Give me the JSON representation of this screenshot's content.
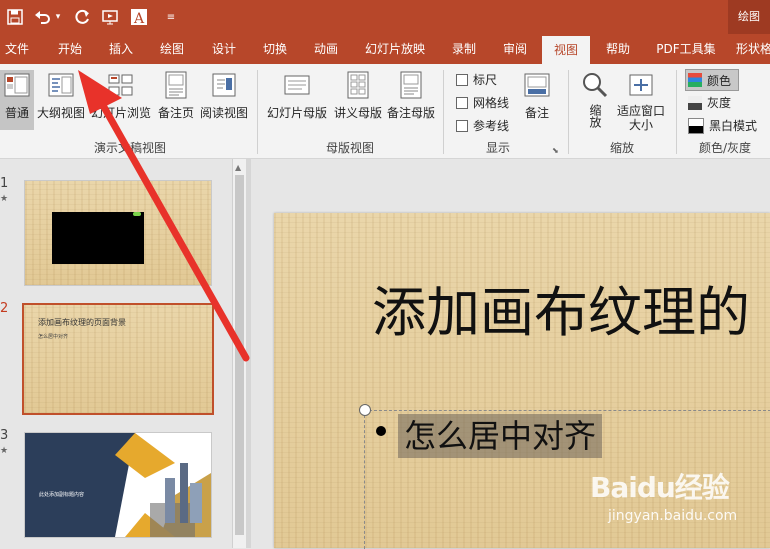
{
  "title_bar": {
    "context_title": "绘图",
    "qat_icons": [
      "save-icon",
      "undo-icon",
      "undo-dropdown-icon",
      "redo-icon",
      "present-from-start-icon",
      "text-style-icon",
      "customize-qat-icon"
    ]
  },
  "tabs": [
    "文件",
    "开始",
    "插入",
    "绘图",
    "设计",
    "切换",
    "动画",
    "幻灯片放映",
    "录制",
    "审阅",
    "视图",
    "帮助",
    "PDF工具集",
    "形状格"
  ],
  "active_tab": "视图",
  "ribbon": {
    "presentation_views": {
      "label": "演示文稿视图",
      "buttons": [
        "普通",
        "大纲视图",
        "幻灯片浏览",
        "备注页",
        "阅读视图"
      ],
      "selected": "普通"
    },
    "master_views": {
      "label": "母版视图",
      "buttons": [
        "幻灯片母版",
        "讲义母版",
        "备注母版"
      ]
    },
    "show": {
      "label": "显示",
      "checkboxes": [
        "标尺",
        "网格线",
        "参考线"
      ],
      "notes_button": "备注"
    },
    "zoom": {
      "label": "缩放",
      "buttons": [
        "缩放",
        "适应窗口大小"
      ]
    },
    "color_grayscale": {
      "label": "颜色/灰度",
      "options": [
        "颜色",
        "灰度",
        "黑白模式"
      ],
      "selected": "颜色"
    }
  },
  "slides": [
    {
      "number": "1",
      "has_star": true
    },
    {
      "number": "2",
      "has_star": false,
      "title": "添加画布纹理的页面背景",
      "bullet": "怎么居中对齐"
    },
    {
      "number": "3",
      "has_star": true,
      "text": "此处添加副标题内容"
    }
  ],
  "current_slide": {
    "title": "添加画布纹理的",
    "bullet": "怎么居中对齐"
  },
  "watermark": {
    "brand": "Baidu经验",
    "url": "jingyan.baidu.com"
  },
  "colors": {
    "accent": "#b7472a",
    "ribbon_bg": "#f3f3f3",
    "arrow": "#e8322a"
  }
}
